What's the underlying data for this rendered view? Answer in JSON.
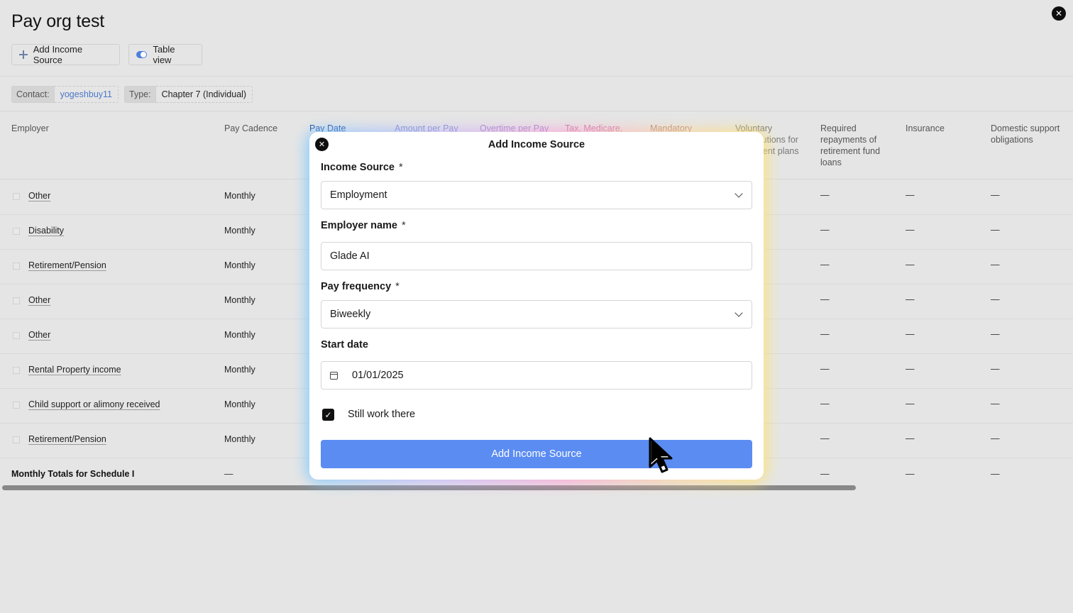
{
  "page": {
    "title": "Pay org test",
    "close_glyph": "✕"
  },
  "toolbar": {
    "add_label": "Add Income Source",
    "view_label": "Table view"
  },
  "filters": {
    "contact_key": "Contact:",
    "contact_value": "yogeshbuy11",
    "type_key": "Type:",
    "type_value": "Chapter 7 (Individual)"
  },
  "table": {
    "headers": {
      "employer": "Employer",
      "pay_cadence": "Pay Cadence",
      "pay_date": "Pay Date",
      "amount": "Amount per Pay",
      "overtime": "Overtime per Pay",
      "tax": "Tax, Medicare,",
      "mandatory": "Mandatory",
      "voluntary": "Voluntary contributions for retirement plans",
      "required": "Required repayments of retirement fund loans",
      "insurance": "Insurance",
      "domestic": "Domestic support obligations"
    },
    "rows": [
      {
        "employer": "Other",
        "cadence": "Monthly"
      },
      {
        "employer": "Disability",
        "cadence": "Monthly"
      },
      {
        "employer": "Retirement/Pension",
        "cadence": "Monthly"
      },
      {
        "employer": "Other",
        "cadence": "Monthly"
      },
      {
        "employer": "Other",
        "cadence": "Monthly"
      },
      {
        "employer": "Rental Property income",
        "cadence": "Monthly"
      },
      {
        "employer": "Child support or alimony received",
        "cadence": "Monthly"
      },
      {
        "employer": "Retirement/Pension",
        "cadence": "Monthly"
      }
    ],
    "empty_value": "—",
    "totals_label": "Monthly Totals for Schedule I"
  },
  "modal": {
    "title": "Add Income Source",
    "income_source_label": "Income Source",
    "income_source_value": "Employment",
    "employer_name_label": "Employer name",
    "employer_name_value": "Glade AI",
    "pay_frequency_label": "Pay frequency",
    "pay_frequency_value": "Biweekly",
    "start_date_label": "Start date",
    "start_date_value": "01/01/2025",
    "still_work_label": "Still work there",
    "still_work_checked": true,
    "required_mark": "*",
    "submit_label": "Add Income Source"
  },
  "colors": {
    "accent": "#5b8cf2",
    "link": "#4c77c9"
  }
}
